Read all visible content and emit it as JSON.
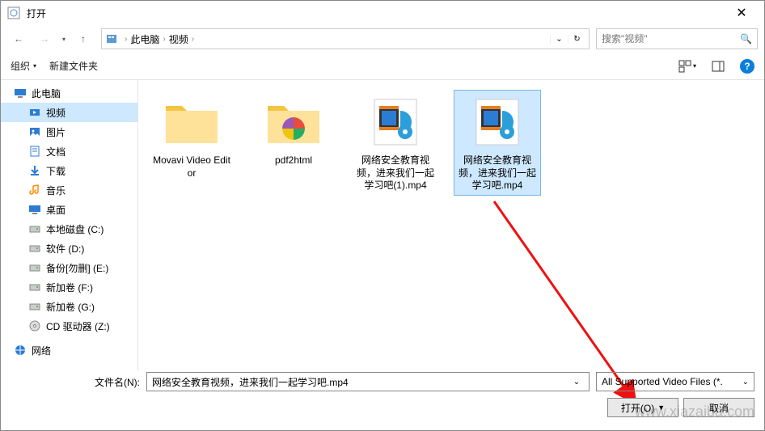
{
  "window": {
    "title": "打开",
    "close_glyph": "✕"
  },
  "nav": {
    "back_glyph": "←",
    "forward_glyph": "→",
    "up_glyph": "↑",
    "refresh_glyph": "↻"
  },
  "breadcrumb": {
    "root": "此电脑",
    "folder": "视频"
  },
  "search": {
    "placeholder": "搜索\"视频\"",
    "icon_glyph": "🔍"
  },
  "toolbar": {
    "organize": "组织",
    "newfolder": "新建文件夹",
    "help_glyph": "?"
  },
  "sidebar": {
    "pc": "此电脑",
    "items": [
      {
        "label": "视频",
        "selected": true
      },
      {
        "label": "图片"
      },
      {
        "label": "文档"
      },
      {
        "label": "下载"
      },
      {
        "label": "音乐"
      },
      {
        "label": "桌面"
      },
      {
        "label": "本地磁盘 (C:)"
      },
      {
        "label": "软件 (D:)"
      },
      {
        "label": "备份[勿删] (E:)"
      },
      {
        "label": "新加卷 (F:)"
      },
      {
        "label": "新加卷 (G:)"
      },
      {
        "label": "CD 驱动器 (Z:)"
      }
    ],
    "network": "网络"
  },
  "files": [
    {
      "type": "folder",
      "label": "Movavi Video Editor"
    },
    {
      "type": "folder-color",
      "label": "pdf2html"
    },
    {
      "type": "video",
      "label": "网络安全教育视频，进来我们一起学习吧(1).mp4"
    },
    {
      "type": "video",
      "label": "网络安全教育视频，进来我们一起学习吧.mp4",
      "selected": true
    }
  ],
  "footer": {
    "filename_label": "文件名(N):",
    "filename_value": "网络安全教育视频，进来我们一起学习吧.mp4",
    "filter": "All Supported Video Files (*.",
    "open": "打开(O)",
    "cancel": "取消"
  },
  "watermark": "www.xiazaiba.com"
}
